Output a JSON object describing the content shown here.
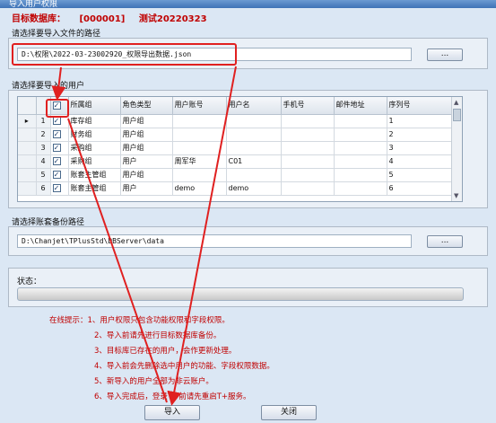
{
  "window": {
    "title": "导入用户权限"
  },
  "target_db": {
    "label": "目标数据库：",
    "code": "[000001]",
    "name": "测试20220323"
  },
  "import_file": {
    "group_label": "请选择要导入文件的路径",
    "path": "D:\\权限\\2022-03-23002920_权限导出数据.json",
    "browse_label": "..."
  },
  "users": {
    "group_label": "请选择要导入的用户",
    "columns": [
      "所属组",
      "角色类型",
      "用户账号",
      "用户名",
      "手机号",
      "邮件地址",
      "序列号"
    ],
    "rows": [
      {
        "num": "1",
        "checked": true,
        "group": "库存组",
        "role": "用户组",
        "account": "",
        "name": "",
        "phone": "",
        "email": "",
        "serial": "1"
      },
      {
        "num": "2",
        "checked": true,
        "group": "财务组",
        "role": "用户组",
        "account": "",
        "name": "",
        "phone": "",
        "email": "",
        "serial": "2"
      },
      {
        "num": "3",
        "checked": true,
        "group": "采购组",
        "role": "用户组",
        "account": "",
        "name": "",
        "phone": "",
        "email": "",
        "serial": "3"
      },
      {
        "num": "4",
        "checked": true,
        "group": "采购组",
        "role": "用户",
        "account": "周军华",
        "name": "C01",
        "phone": "",
        "email": "",
        "serial": "4"
      },
      {
        "num": "5",
        "checked": true,
        "group": "账套主管组",
        "role": "用户组",
        "account": "",
        "name": "",
        "phone": "",
        "email": "",
        "serial": "5"
      },
      {
        "num": "6",
        "checked": true,
        "group": "账套主管组",
        "role": "用户",
        "account": "demo",
        "name": "demo",
        "phone": "",
        "email": "",
        "serial": "6"
      }
    ]
  },
  "backup": {
    "group_label": "请选择账套备份路径",
    "path": "D:\\Chanjet\\TPlusStd\\DBServer\\data",
    "browse_label": "..."
  },
  "status": {
    "label": "状态："
  },
  "tips": {
    "heading": "在线提示：",
    "items": [
      "1、用户权限只包含功能权限和字段权限。",
      "2、导入前请先进行目标数据库备份。",
      "3、目标库已存在的用户，会作更新处理。",
      "4、导入前会先删除选中用户的功能、字段权限数据。",
      "5、新导入的用户全部为非云账户。",
      "6、导入完成后，登录T+前请先重启T+服务。"
    ]
  },
  "buttons": {
    "import": "导入",
    "close": "关闭"
  },
  "colors": {
    "accent_red": "#e02020",
    "tip_red": "#c00000",
    "background": "#dbe7f4"
  }
}
